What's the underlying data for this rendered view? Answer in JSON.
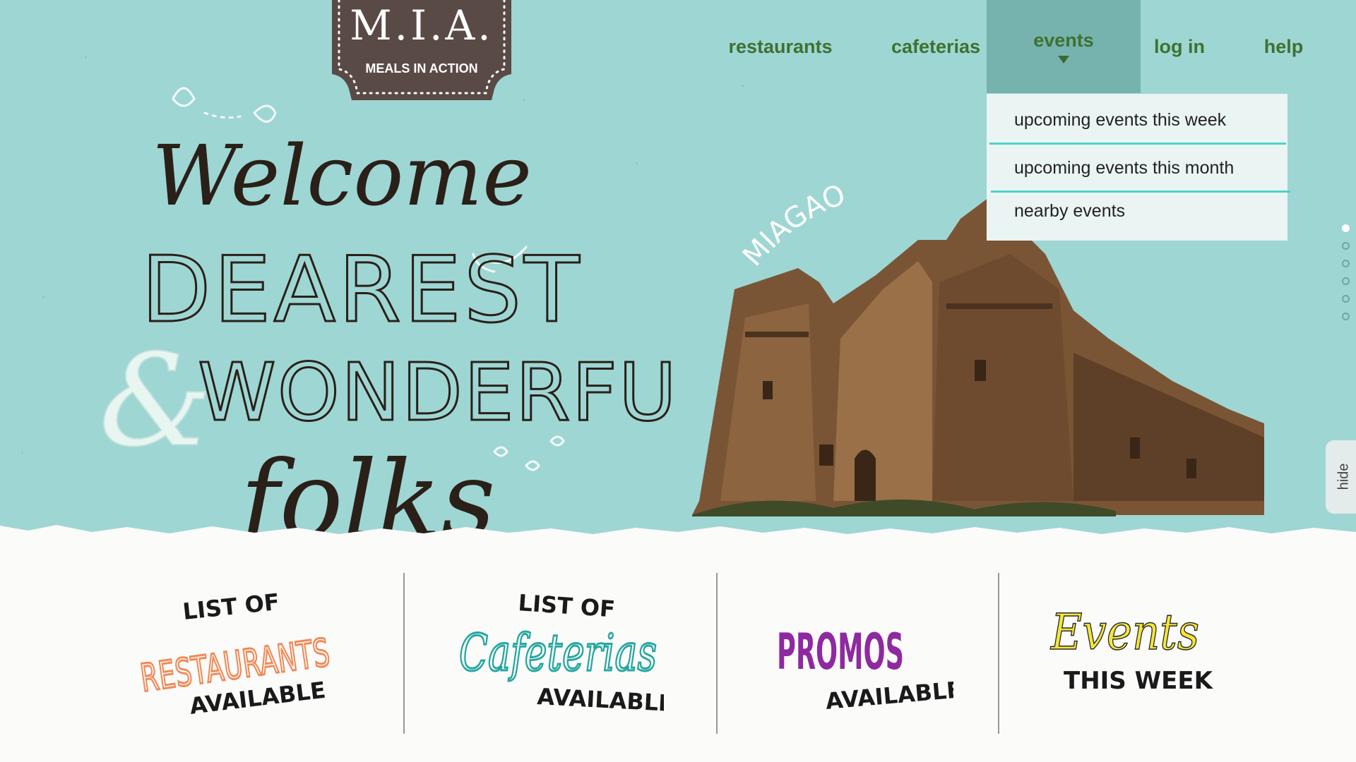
{
  "logo": {
    "title": "M.I.A.",
    "subtitle": "MEALS IN ACTION"
  },
  "nav": {
    "items": [
      {
        "label": "restaurants"
      },
      {
        "label": "cafeterias"
      },
      {
        "label": "events"
      },
      {
        "label": "log in"
      },
      {
        "label": "help"
      }
    ],
    "active_index": 2
  },
  "dropdown": {
    "items": [
      {
        "label": "upcoming events this week"
      },
      {
        "label": "upcoming events this month"
      },
      {
        "label": "nearby events"
      }
    ]
  },
  "hero": {
    "welcome": "Welcome",
    "dearest": "DEAREST",
    "ampersand": "&",
    "wonderful": "WONDERFUL",
    "folks": "folks",
    "landmark_label": "MIAGAO"
  },
  "side_tab": {
    "label": "hide"
  },
  "slides": {
    "count": 6,
    "active": 1
  },
  "promos": [
    {
      "line1": "LIST OF",
      "line2": "RESTAURANTS",
      "line3": "AVAILABLE",
      "color": "#f08a57"
    },
    {
      "line1": "LIST OF",
      "line2": "Cafeterias",
      "line3": "AVAILABLE",
      "color": "#26a7a0"
    },
    {
      "line1": "PROMOS",
      "line2": "AVAILABLE",
      "color": "#8e2aa0"
    },
    {
      "line1": "Events",
      "line2": "THIS WEEK",
      "color": "#f3e63a"
    }
  ],
  "colors": {
    "hero_bg": "#9ed6d4",
    "nav_text": "#3f7130",
    "active_tab": "#76b3ae",
    "dropdown_rule": "#4fd3c6",
    "logo_bg": "#5a4a45"
  }
}
